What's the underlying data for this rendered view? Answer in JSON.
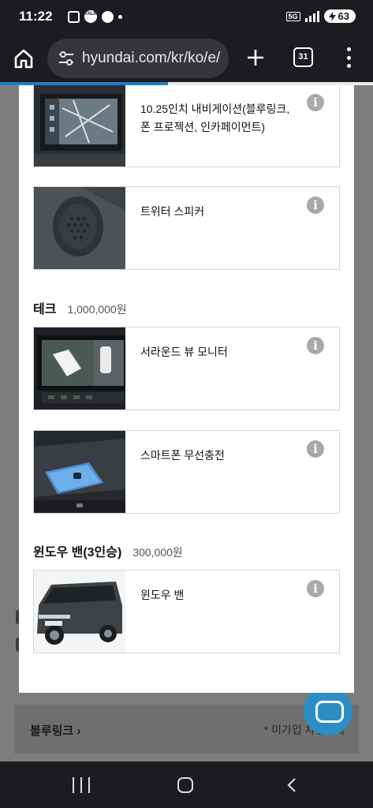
{
  "status": {
    "time": "11:22",
    "network": "5G",
    "battery": "63",
    "notif_icons": [
      "screenshot-icon",
      "talk-icon",
      "chat-bubble-icon"
    ]
  },
  "browser": {
    "url": "hyundai.com/kr/ko/e/",
    "tab_count": "31",
    "load_progress": 0.45
  },
  "modal": {
    "items": [
      {
        "name": "10.25인치 내비게이션(블루링크, 폰 프로젝션, 인카페이먼트)",
        "image": "navigation-screen"
      },
      {
        "name": "트위터 스피커",
        "image": "tweeter-speaker"
      }
    ],
    "groups": [
      {
        "name": "테크",
        "price": "1,000,000원",
        "items": [
          {
            "name": "서라운드 뷰 모니터",
            "image": "surround-view-monitor"
          },
          {
            "name": "스마트폰 무선충전",
            "image": "wireless-charging-pad"
          }
        ]
      },
      {
        "name": "윈도우 밴(3인승)",
        "price": "300,000원",
        "items": [
          {
            "name": "윈도우 밴",
            "image": "window-van-car"
          }
        ]
      }
    ],
    "info_glyph": "i"
  },
  "background": {
    "link": "블루링크",
    "note": "* 미가입 차량 0대"
  },
  "colors": {
    "progress": "#1f7cc4",
    "chat_fab": "#2d8ec4",
    "info_icon": "#a9a9a9"
  }
}
